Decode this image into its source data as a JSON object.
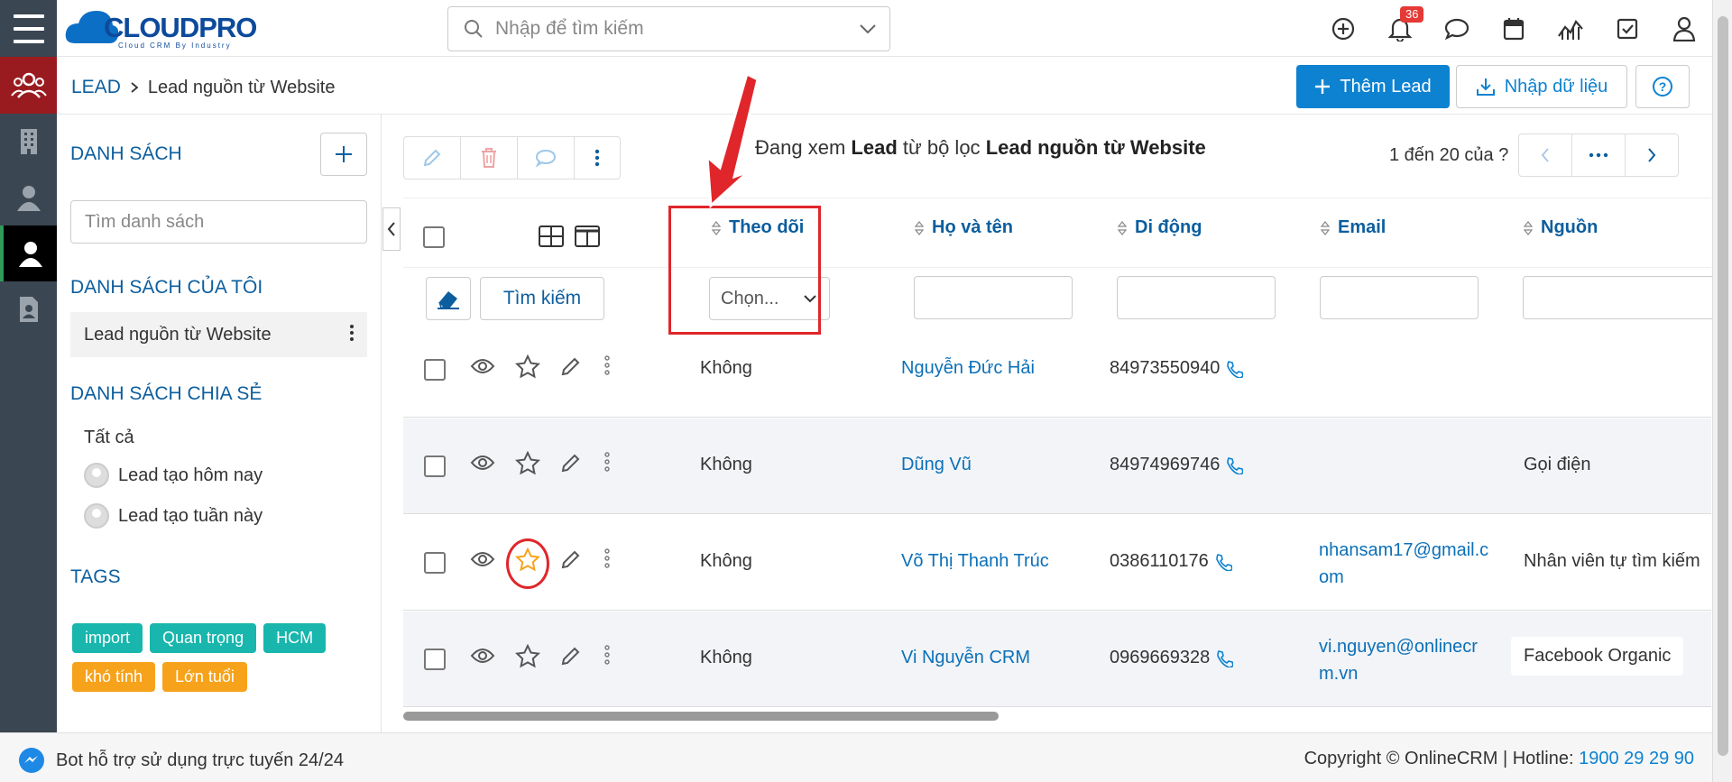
{
  "app": {
    "logo_text": "CLOUDPRO",
    "logo_sub": "Cloud CRM By Industry"
  },
  "search": {
    "placeholder": "Nhập để tìm kiếm"
  },
  "notifications": {
    "count": "36"
  },
  "breadcrumb": {
    "module": "LEAD",
    "current": "Lead nguồn từ Website"
  },
  "actions": {
    "add_label": "Thêm Lead",
    "import_label": "Nhập dữ liệu"
  },
  "sidebar": {
    "lists_title": "DANH SÁCH",
    "search_placeholder": "Tìm danh sách",
    "my_lists_title": "DANH SÁCH CỦA TÔI",
    "my_lists": [
      "Lead nguồn từ Website"
    ],
    "shared_title": "DANH SÁCH CHIA SẺ",
    "shared": [
      "Tất cả",
      "Lead tạo hôm nay",
      "Lead tạo tuần này"
    ],
    "tags_title": "TAGS",
    "tags": [
      {
        "label": "import",
        "color": "#18b6ac"
      },
      {
        "label": "Quan trọng",
        "color": "#18b6ac"
      },
      {
        "label": "HCM",
        "color": "#18b6ac"
      },
      {
        "label": "khó tính",
        "color": "#f7a21b"
      },
      {
        "label": "Lớn tuổi",
        "color": "#f7a21b"
      }
    ]
  },
  "viewing": {
    "prefix": "Đang xem",
    "module": "Lead",
    "middle": "từ bộ lọc",
    "filter": "Lead nguồn từ Website"
  },
  "pager": {
    "text": "1 đến 20 của",
    "unknown": "?"
  },
  "table": {
    "columns": [
      "Theo dõi",
      "Họ và tên",
      "Di động",
      "Email",
      "Nguồn"
    ],
    "search_button": "Tìm kiếm",
    "follow_select": "Chọn...",
    "rows": [
      {
        "follow": "Không",
        "name": "Nguyễn Đức Hải",
        "mobile": "84973550940",
        "email": "",
        "source": ""
      },
      {
        "follow": "Không",
        "name": "Dũng Vũ",
        "mobile": "84974969746",
        "email": "",
        "source": "Gọi điện"
      },
      {
        "follow": "Không",
        "name": "Võ Thị Thanh Trúc",
        "mobile": "0386110176",
        "email": "nhansam17@gmail.com",
        "source": "Nhân viên tự tìm kiếm"
      },
      {
        "follow": "Không",
        "name": "Vi Nguyễn CRM",
        "mobile": "0969669328",
        "email": "vi.nguyen@onlinecrm.vn",
        "source": "Facebook Organic"
      }
    ]
  },
  "footer": {
    "bot": "Bot hỗ trợ sử dụng trực tuyến 24/24",
    "copyright": "Copyright © OnlineCRM | Hotline:",
    "hotline": "1900 29 29 90"
  },
  "colors": {
    "accent": "#0d82d1",
    "rail": "#3a4651",
    "highlight": "#e0262b",
    "star_active": "#f7a21b"
  }
}
